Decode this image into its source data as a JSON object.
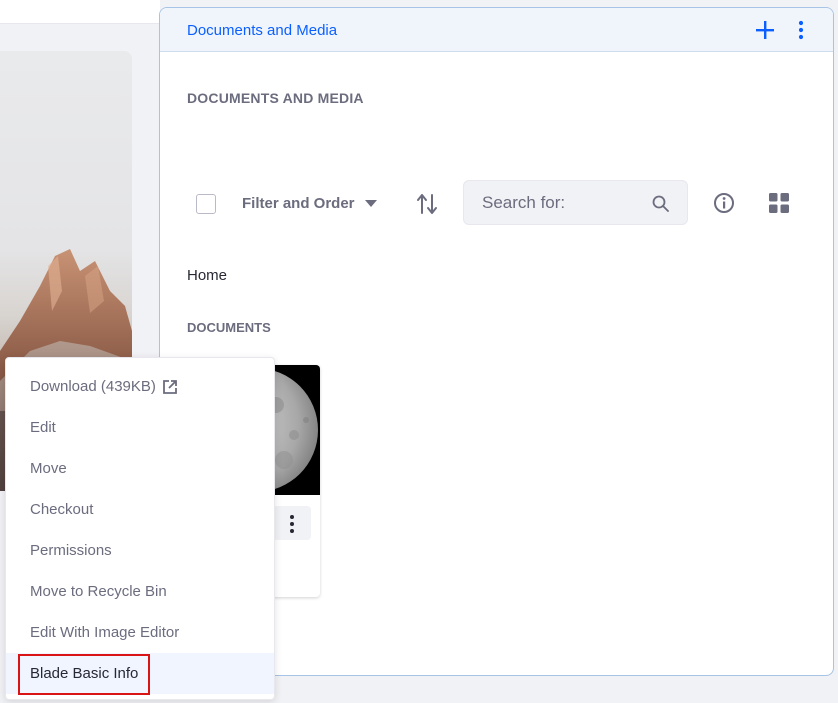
{
  "portlet": {
    "title": "Documents and Media",
    "section_heading": "DOCUMENTS AND MEDIA"
  },
  "toolbar": {
    "filter_order_label": "Filter and Order",
    "search_placeholder": "Search for:"
  },
  "breadcrumb": {
    "home": "Home"
  },
  "documents_heading": "DOCUMENTS",
  "icons": {
    "add": "plus-icon",
    "topper_menu": "vertical-ellipsis-icon",
    "sort": "sort-arrows-icon",
    "search": "search-icon",
    "info": "info-circle-icon",
    "view": "grid-view-icon",
    "external": "external-link-icon",
    "filter_caret": "caret-down-icon"
  },
  "colors": {
    "accent": "#0b5fff",
    "highlight": "#da1414",
    "active_item_bg": "#f0f5ff"
  },
  "context_menu": {
    "items": [
      {
        "label": "Download (439KB)"
      },
      {
        "label": "Edit"
      },
      {
        "label": "Move"
      },
      {
        "label": "Checkout"
      },
      {
        "label": "Permissions"
      },
      {
        "label": "Move to Recycle Bin"
      },
      {
        "label": "Edit With Image Editor"
      },
      {
        "label": "Blade Basic Info"
      }
    ],
    "highlighted_item": "Blade Basic Info"
  }
}
